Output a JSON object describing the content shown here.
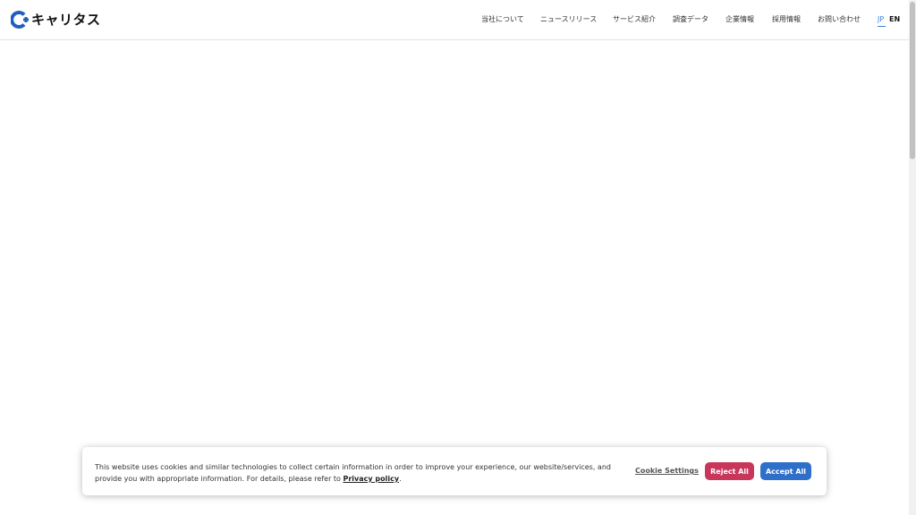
{
  "header": {
    "logo_text": "キャリタス",
    "nav": [
      {
        "label": "当社について"
      },
      {
        "label": "ニュースリリース"
      },
      {
        "label": "サービス紹介"
      },
      {
        "label": "調査データ"
      },
      {
        "label": "企業情報"
      },
      {
        "label": "採用情報"
      },
      {
        "label": "お問い合わせ"
      }
    ],
    "lang": {
      "jp": "JP",
      "en": "EN"
    }
  },
  "cookie_banner": {
    "text_before": "This website uses cookies and similar technologies to collect certain information in order to improve your experience, our website/services, and provide you with appropriate information. For details, please refer to ",
    "privacy_link": "Privacy policy",
    "text_after": ".",
    "settings_label": "Cookie Settings",
    "reject_label": "Reject All",
    "accept_label": "Accept All"
  },
  "colors": {
    "accent_blue": "#2e6fc9",
    "reject_red": "#c8375a",
    "logo_blue": "#1f5fbf"
  }
}
